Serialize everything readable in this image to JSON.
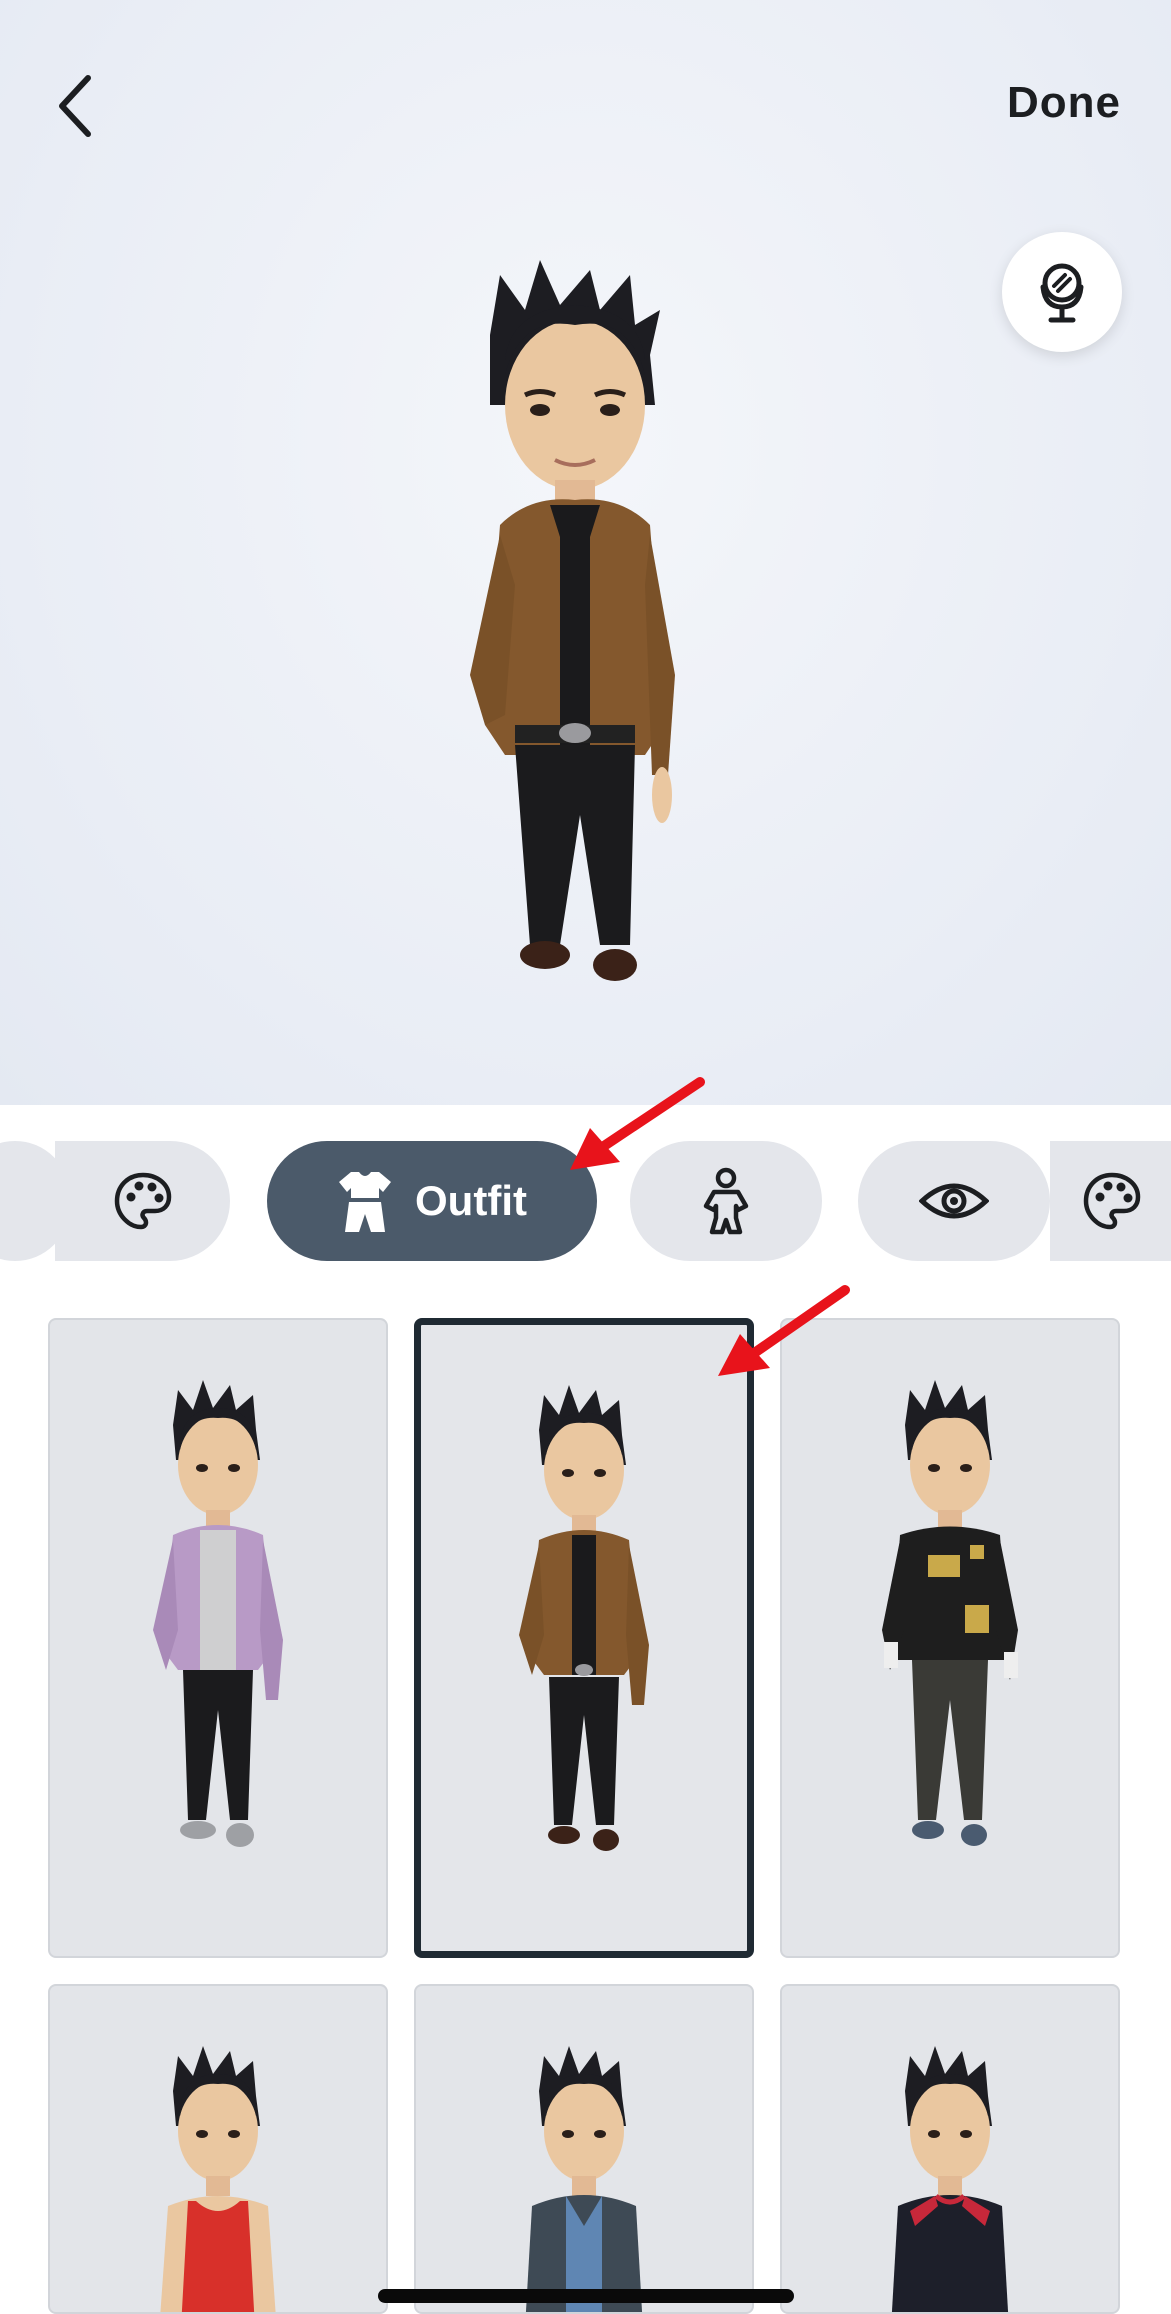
{
  "header": {
    "done_label": "Done"
  },
  "icons": {
    "back": "chevron-left-icon",
    "mirror": "mirror-icon",
    "palette": "palette-icon",
    "outfit": "outfit-icon",
    "body": "body-icon",
    "eye": "eye-icon"
  },
  "tabs": [
    {
      "id": "partial-left",
      "label": ""
    },
    {
      "id": "palette",
      "label": ""
    },
    {
      "id": "outfit",
      "label": "Outfit",
      "active": true
    },
    {
      "id": "body",
      "label": ""
    },
    {
      "id": "eye",
      "label": ""
    },
    {
      "id": "palette-2",
      "label": ""
    }
  ],
  "outfits": [
    {
      "name": "lavender-jacket",
      "selected": false
    },
    {
      "name": "brown-blazer",
      "selected": true
    },
    {
      "name": "black-patch-sweater",
      "selected": false
    },
    {
      "name": "red-tank-top",
      "selected": false
    },
    {
      "name": "denim-shirt",
      "selected": false
    },
    {
      "name": "sport-top",
      "selected": false
    }
  ],
  "colors": {
    "active_tab": "#4b5a6a",
    "tab_bg": "#e4e6eb",
    "annotation_arrow": "#e8131b"
  }
}
